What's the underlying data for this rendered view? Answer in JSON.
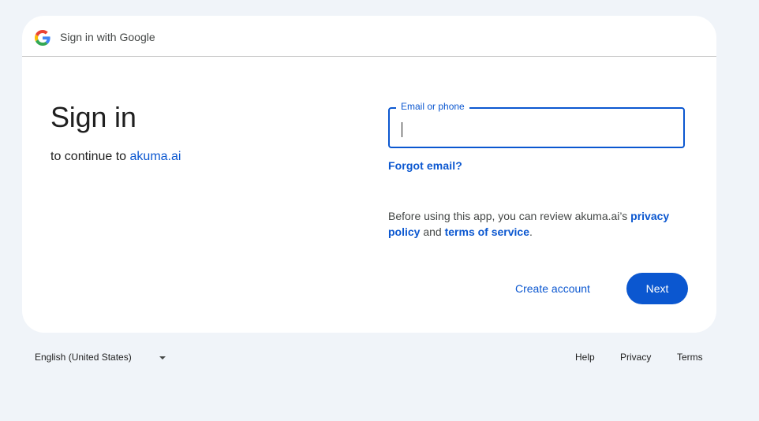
{
  "header": {
    "title": "Sign in with Google",
    "logo_icon": "google-g-icon"
  },
  "main": {
    "title": "Sign in",
    "subtitle_prefix": "to continue to",
    "app_link": "akuma.ai"
  },
  "form": {
    "email_label": "Email or phone",
    "email_value": "",
    "forgot_link": "Forgot email?"
  },
  "notice": {
    "before_text": "Before using this app, you can review akuma.ai’s",
    "privacy_link": "privacy policy",
    "and_text": "and",
    "terms_link": "terms of service",
    "end_text": "."
  },
  "actions": {
    "create_account": "Create account",
    "next": "Next"
  },
  "footer": {
    "language": "English (United States)",
    "help": "Help",
    "privacy": "Privacy",
    "terms": "Terms"
  },
  "colors": {
    "accent": "#0b57d0",
    "background": "#f0f4f9",
    "card": "#ffffff",
    "text": "#1f1f1f"
  }
}
